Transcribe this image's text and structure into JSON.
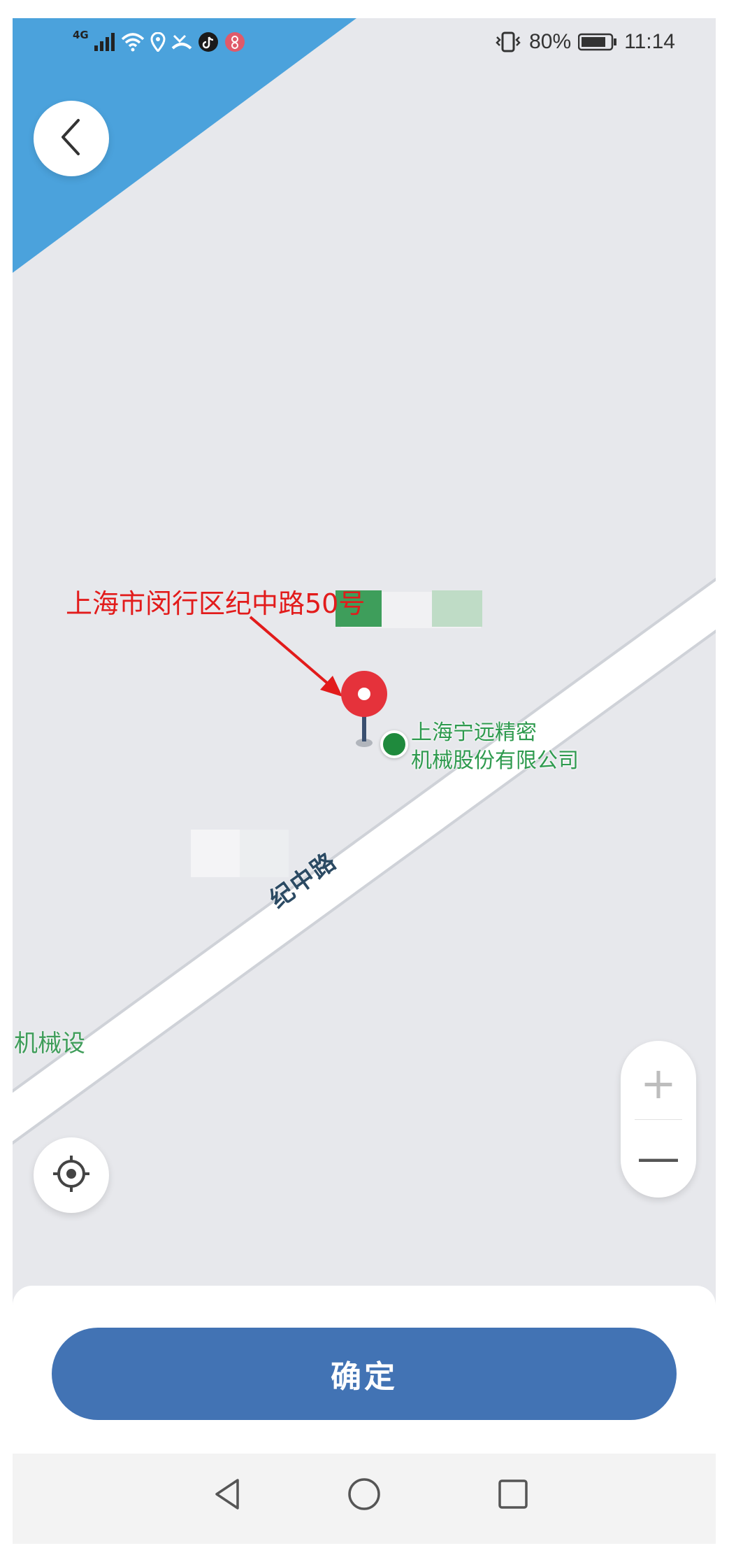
{
  "status_bar": {
    "network": "4G",
    "battery_percent": "80%",
    "time": "11:14"
  },
  "map": {
    "annotation": "上海市闵行区纪中路50号",
    "poi_name_line1": "上海宁远精密",
    "poi_name_line2": "机械股份有限公司",
    "road_name": "纪中路",
    "edge_label": "机械设"
  },
  "controls": {
    "zoom_in": "+",
    "zoom_out": "—"
  },
  "bottom": {
    "confirm_label": "确定"
  },
  "icons": [
    "back-chevron-icon",
    "locate-crosshair-icon",
    "location-pin-icon",
    "nav-back-icon",
    "nav-home-icon",
    "nav-recents-icon"
  ],
  "colors": {
    "accent": "#4273b4",
    "pin": "#e5323b",
    "poi": "#1f8a3d",
    "water": "#4ba2dc"
  }
}
